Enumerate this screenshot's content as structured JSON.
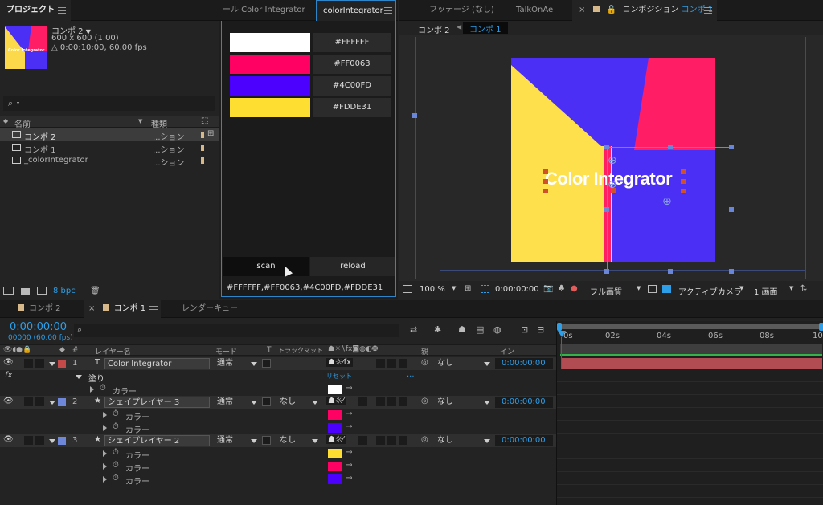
{
  "project": {
    "tab_label": "プロジェクト",
    "comp_name": "コンポ 2",
    "comp_size": "600 x 600 (1.00)",
    "comp_duration": "△ 0:00:10:00, 60.00 fps",
    "thumb_text": "Color Integrator",
    "search_placeholder": "",
    "col_name": "名前",
    "col_type": "種類",
    "items": [
      {
        "name": "コンポ 2",
        "type": "...ション"
      },
      {
        "name": "コンポ 1",
        "type": "...ション"
      },
      {
        "name": "_colorIntegrator",
        "type": "...ション"
      }
    ],
    "bpc": "8 bpc"
  },
  "integrator": {
    "tab_prev": "ール Color Integrator",
    "tab_active": "colorIntegrator",
    "swatches": [
      {
        "hex": "#FFFFFF",
        "color": "#FFFFFF"
      },
      {
        "hex": "#FF0063",
        "color": "#FF0063"
      },
      {
        "hex": "#4C00FD",
        "color": "#4C00FD"
      },
      {
        "hex": "#FDDE31",
        "color": "#FDDE31"
      }
    ],
    "scan_label": "scan",
    "reload_label": "reload",
    "output": "#FFFFFF,#FF0063,#4C00FD,#FDDE31"
  },
  "viewer": {
    "tab_footage": "フッテージ (なし)",
    "tab_talk": "TalkOnAe",
    "tab_comp_prefix": "コンポジション",
    "tab_comp_name": "コンポ 1",
    "crumb_1": "コンポ 2",
    "crumb_2": "コンポ 1",
    "canvas_text": "Color Integrator",
    "zoom": "100 %",
    "timecode": "0:00:00:00",
    "quality": "フル画質",
    "camera": "アクティブカメラ",
    "views": "1 画面"
  },
  "timeline": {
    "tab_comp2": "コンポ 2",
    "tab_comp1": "コンポ 1",
    "tab_render": "レンダーキュー",
    "timecode": "0:00:00:00",
    "fps": "00000 (60.00 fps)",
    "col_num": "#",
    "col_layer": "レイヤー名",
    "col_mode": "モード",
    "col_t": "T",
    "col_matte": "トラックマット",
    "col_parent": "親",
    "col_in": "イン",
    "ruler": [
      "0s",
      "02s",
      "04s",
      "06s",
      "08s",
      "10"
    ],
    "layers": [
      {
        "num": "1",
        "name": "Color Integrator",
        "mode": "通常",
        "matte": "",
        "parent": "なし",
        "in": "0:00:00:00",
        "label_color": "#c44a4a",
        "bar_color": "#b04c52"
      },
      {
        "num": "2",
        "name": "シェイプレイヤー 3",
        "mode": "通常",
        "matte": "なし",
        "parent": "なし",
        "in": "0:00:00:00",
        "label_color": "#6f87d8",
        "bar_color": "#5a6fc8"
      },
      {
        "num": "3",
        "name": "シェイプレイヤー 2",
        "mode": "通常",
        "matte": "なし",
        "parent": "なし",
        "in": "0:00:00:00",
        "label_color": "#6f87d8",
        "bar_color": "#5a6fc8"
      }
    ],
    "fill_label": "塗り",
    "reset_label": "リセット",
    "reset_dots": "...",
    "color_label": "カラー",
    "props": [
      {
        "row": 0,
        "color": "#FFFFFF"
      },
      {
        "row": 1,
        "color": "#FF0063"
      },
      {
        "row": 2,
        "color": "#4C00FD"
      },
      {
        "row": 3,
        "color": "#FDDE31"
      },
      {
        "row": 4,
        "color": "#FF0063"
      },
      {
        "row": 5,
        "color": "#4C00FD"
      }
    ]
  }
}
